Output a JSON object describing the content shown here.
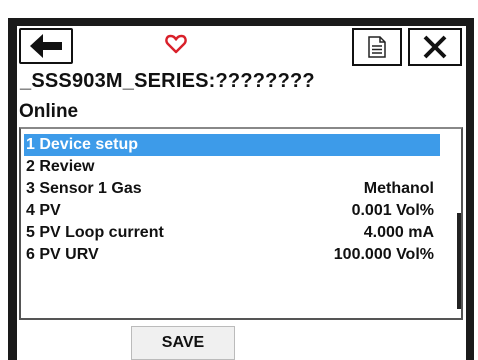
{
  "header": {
    "back_icon": "arrow-left-icon",
    "favorite_icon": "heart-outline-icon",
    "document_icon": "document-icon",
    "close_icon": "close-x-icon"
  },
  "device_title": "_SSS903M_SERIES:????????",
  "status": "Online",
  "menu": {
    "items": [
      {
        "label": "1 Device setup",
        "value": "",
        "selected": true
      },
      {
        "label": "2 Review",
        "value": "",
        "selected": false
      },
      {
        "label": "3 Sensor 1 Gas",
        "value": "Methanol",
        "selected": false
      },
      {
        "label": "4 PV",
        "value": "0.001 Vol%",
        "selected": false
      },
      {
        "label": "5 PV Loop current",
        "value": "4.000 mA",
        "selected": false
      },
      {
        "label": "6 PV URV",
        "value": "100.000 Vol%",
        "selected": false
      }
    ]
  },
  "footer": {
    "save_label": "SAVE"
  },
  "colors": {
    "selection": "#3d9be9",
    "heart": "#d9202a",
    "frame": "#1a1a1a"
  }
}
